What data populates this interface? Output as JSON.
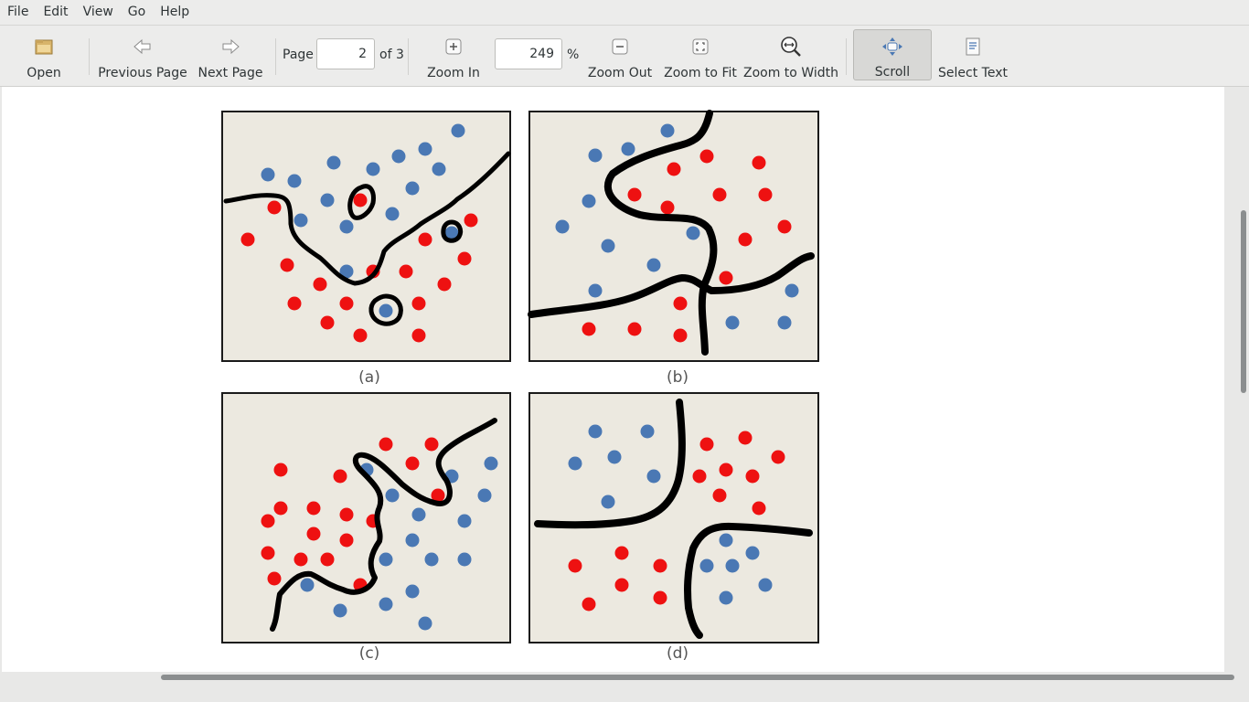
{
  "menubar": {
    "items": [
      "File",
      "Edit",
      "View",
      "Go",
      "Help"
    ]
  },
  "toolbar": {
    "open_label": "Open",
    "prev_label": "Previous Page",
    "next_label": "Next Page",
    "page_label": "Page",
    "page_value": "2",
    "page_total": "of 3",
    "zoom_in_label": "Zoom In",
    "zoom_value": "249",
    "zoom_unit": "%",
    "zoom_out_label": "Zoom Out",
    "zoom_fit_label": "Zoom to Fit",
    "zoom_width_label": "Zoom to Width",
    "scroll_label": "Scroll",
    "select_text_label": "Select Text"
  },
  "document": {
    "panel_labels": [
      "(a)",
      "(b)",
      "(c)",
      "(d)"
    ],
    "colors": {
      "blue_point": "#4a78b4",
      "red_point": "#ee1111",
      "panel_bg": "#ece9e0",
      "boundary": "#000000"
    }
  }
}
